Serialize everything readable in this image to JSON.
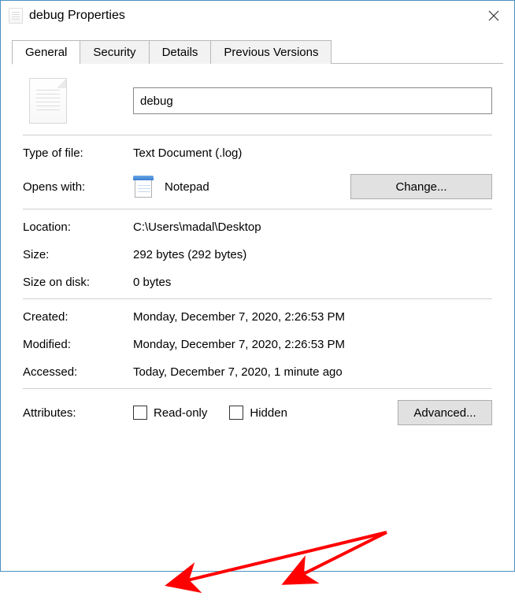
{
  "window": {
    "title": "debug Properties"
  },
  "tabs": {
    "general": "General",
    "security": "Security",
    "details": "Details",
    "previous": "Previous Versions"
  },
  "filename": "debug",
  "rows": {
    "type_label": "Type of file:",
    "type_value": "Text Document (.log)",
    "opens_label": "Opens with:",
    "opens_value": "Notepad",
    "change_btn": "Change...",
    "location_label": "Location:",
    "location_value": "C:\\Users\\madal\\Desktop",
    "size_label": "Size:",
    "size_value": "292 bytes (292 bytes)",
    "sizeondisk_label": "Size on disk:",
    "sizeondisk_value": "0 bytes",
    "created_label": "Created:",
    "created_value": "Monday, December 7, 2020, 2:26:53 PM",
    "modified_label": "Modified:",
    "modified_value": "Monday, December 7, 2020, 2:26:53 PM",
    "accessed_label": "Accessed:",
    "accessed_value": "Today, December 7, 2020, 1 minute ago",
    "attributes_label": "Attributes:",
    "readonly": "Read-only",
    "hidden": "Hidden",
    "advanced_btn": "Advanced..."
  }
}
